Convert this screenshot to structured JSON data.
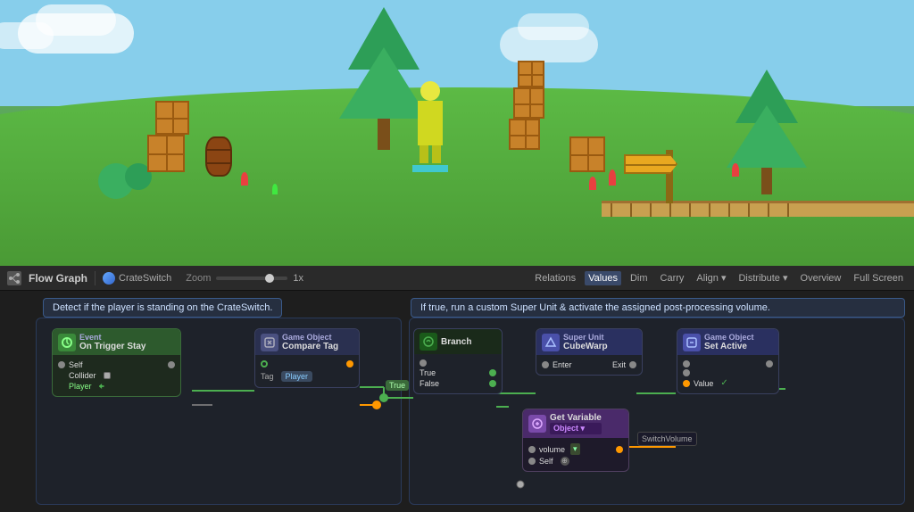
{
  "toolbar": {
    "title": "Flow Graph",
    "breadcrumb": "CrateSwitch",
    "zoom_label": "Zoom",
    "zoom_value": "1x",
    "buttons": [
      "Relations",
      "Values",
      "Dim",
      "Carry",
      "Align ▾",
      "Distribute ▾",
      "Overview",
      "Full Screen"
    ]
  },
  "descriptions": {
    "left": "Detect if the player is standing on the CrateSwitch.",
    "right": "If true, run a custom Super Unit & activate the assigned post-processing volume."
  },
  "nodes": {
    "on_trigger": {
      "label": "On Trigger Stay",
      "sub": "Event",
      "self_label": "Self",
      "collider_label": "Collider",
      "player_label": "Player"
    },
    "compare_tag": {
      "label": "Game Object",
      "label2": "Compare Tag",
      "tag_label": "Tag",
      "tag_value": "Player"
    },
    "branch": {
      "label": "Branch",
      "true_label": "True",
      "false_label": "False"
    },
    "super_unit": {
      "label": "Super Unit",
      "sub": "CubeWarp",
      "enter_label": "Enter",
      "exit_label": "Exit"
    },
    "set_active": {
      "label": "Game Object",
      "label2": "Set Active",
      "value_label": "Value"
    },
    "get_variable": {
      "label": "Get Variable",
      "sub": "Object ▾",
      "volume_label": "volume",
      "self_label": "Self",
      "switch_volume": "SwitchVolume"
    }
  },
  "true_badge": "True"
}
